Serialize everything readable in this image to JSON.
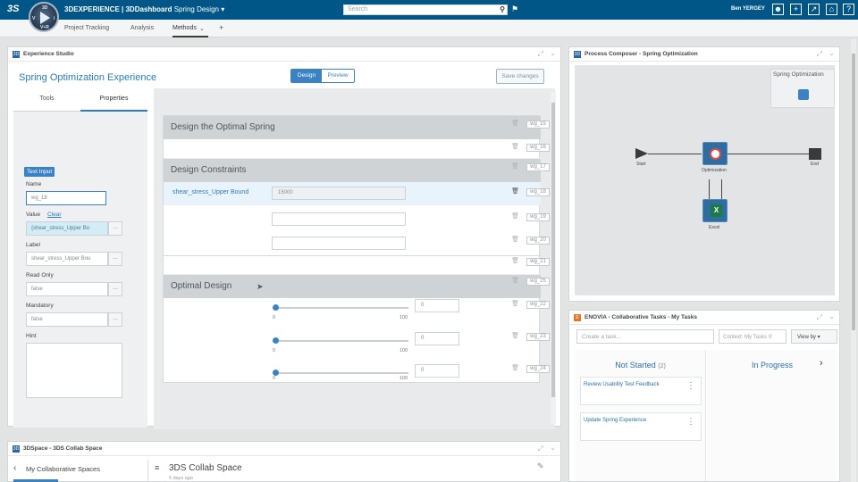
{
  "topbar": {
    "logo": "3S",
    "app_brand": "3DEXPERIENCE",
    "app_sep": " | ",
    "app_name": "3DDashboard",
    "dashboard_name": " Spring Design",
    "search_placeholder": "Search",
    "user_name": "Ben YERGEY",
    "compass_quadrants": [
      "3D",
      "V",
      "i",
      "V+R"
    ]
  },
  "tabs": [
    {
      "label": "Project Tracking"
    },
    {
      "label": "Analysis"
    },
    {
      "label": "Methods",
      "active": true
    },
    {
      "label": "+"
    }
  ],
  "experience_studio": {
    "widget_title": "Experience Studio",
    "title": "Spring Optimization Experience",
    "mode_design": "Design",
    "mode_preview": "Preview",
    "save_label": "Save changes",
    "left_tabs": {
      "tools": "Tools",
      "properties": "Properties"
    },
    "properties": {
      "component_type": "Text Input",
      "name_label": "Name",
      "name_value": "wg_18",
      "value_label": "Value",
      "value_clear": "Clear",
      "value_value": "{shear_stress_Upper Bo",
      "label_label": "Label",
      "label_value": "shear_stress_Upper Bou",
      "readonly_label": "Read Only",
      "readonly_value": "false",
      "mandatory_label": "Mandatory",
      "mandatory_value": "false",
      "hint_label": "Hint",
      "ellipsis": "..."
    },
    "form": {
      "sections": {
        "design": "Design the Optimal Spring",
        "constraints": "Design Constraints",
        "optimal": "Optimal Design"
      },
      "field_label": "shear_stress_Upper Bound",
      "field_value": "15000",
      "wg": [
        "wg_15",
        "wg_16",
        "wg_17",
        "wg_18",
        "wg_19",
        "wg_20",
        "wg_21",
        "wg_25",
        "wg_22",
        "wg_23",
        "wg_24"
      ],
      "slider_min": "0",
      "slider_max": "100",
      "slider_values": [
        "0",
        "0",
        "0"
      ]
    }
  },
  "process_composer": {
    "widget_title": "Process Composer - Spring Optimization",
    "mini_label": "Spring Optimization",
    "nodes": {
      "start": "Start",
      "optimization": "Optimization",
      "end": "End",
      "excel": "Excel"
    }
  },
  "enovia": {
    "widget_title": "ENOVIA - Collaborative Tasks - My Tasks",
    "create_placeholder": "Create a task...",
    "context_placeholder": "Context: My Tasks",
    "viewby_label": "View by",
    "not_started": "Not Started",
    "not_started_count": "(2)",
    "in_progress": "In Progress",
    "tasks": [
      "Review Usability Test Feedback",
      "Update Spring Experience"
    ]
  },
  "space": {
    "widget_title": "3DSpace - 3DS Collab Space",
    "back_label": "My Collaborative Spaces",
    "space_title": "3DS Collab Space",
    "space_meta": "5 days ago"
  },
  "colors": {
    "topbar": "#005686",
    "accent": "#3a82c4",
    "link": "#2b7bbd"
  }
}
